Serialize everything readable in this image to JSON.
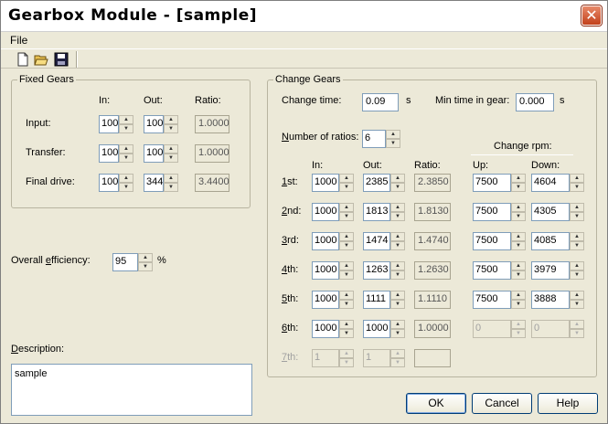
{
  "window": {
    "title": "Gearbox Module - [sample]",
    "close": "✕"
  },
  "menu": {
    "file": "File"
  },
  "fixed": {
    "label": "Fixed Gears",
    "headers": {
      "in": "In:",
      "out": "Out:",
      "ratio": "Ratio:"
    },
    "rows": [
      {
        "label": "Input:",
        "in": "100",
        "out": "100",
        "ratio": "1.0000"
      },
      {
        "label": "Transfer:",
        "in": "100",
        "out": "100",
        "ratio": "1.0000"
      },
      {
        "label": "Final drive:",
        "in": "100",
        "out": "344",
        "ratio": "3.4400"
      }
    ]
  },
  "efficiency": {
    "label_pre": "Overall ",
    "label_u": "e",
    "label_post": "fficiency:",
    "value": "95",
    "unit": "%"
  },
  "description": {
    "label_u": "D",
    "label_post": "escription:",
    "value": "sample"
  },
  "change": {
    "label": "Change Gears",
    "change_time": {
      "label": "Change time:",
      "value": "0.09",
      "unit": "s"
    },
    "min_time": {
      "label": "Min time in gear:",
      "value": "0.000",
      "unit": "s"
    },
    "num_ratios": {
      "label_u": "N",
      "label_post": "umber of ratios:",
      "value": "6"
    },
    "change_rpm": "Change rpm:",
    "headers": {
      "in": "In:",
      "out": "Out:",
      "ratio": "Ratio:",
      "up": "Up:",
      "down": "Down:"
    },
    "gears": [
      {
        "label_u": "1",
        "label_post": "st:",
        "in": "1000",
        "out": "2385",
        "ratio": "2.3850",
        "up": "7500",
        "down": "4604",
        "enabled": true,
        "rpm_enabled": true
      },
      {
        "label_u": "2",
        "label_post": "nd:",
        "in": "1000",
        "out": "1813",
        "ratio": "1.8130",
        "up": "7500",
        "down": "4305",
        "enabled": true,
        "rpm_enabled": true
      },
      {
        "label_u": "3",
        "label_post": "rd:",
        "in": "1000",
        "out": "1474",
        "ratio": "1.4740",
        "up": "7500",
        "down": "4085",
        "enabled": true,
        "rpm_enabled": true
      },
      {
        "label_u": "4",
        "label_post": "th:",
        "in": "1000",
        "out": "1263",
        "ratio": "1.2630",
        "up": "7500",
        "down": "3979",
        "enabled": true,
        "rpm_enabled": true
      },
      {
        "label_u": "5",
        "label_post": "th:",
        "in": "1000",
        "out": "1111",
        "ratio": "1.1110",
        "up": "7500",
        "down": "3888",
        "enabled": true,
        "rpm_enabled": true
      },
      {
        "label_u": "6",
        "label_post": "th:",
        "in": "1000",
        "out": "1000",
        "ratio": "1.0000",
        "up": "0",
        "down": "0",
        "enabled": true,
        "rpm_enabled": false
      },
      {
        "label_u": "7",
        "label_post": "th:",
        "in": "1",
        "out": "1",
        "ratio": "",
        "enabled": false,
        "rpm_enabled": false
      }
    ]
  },
  "buttons": {
    "ok": "OK",
    "cancel": "Cancel",
    "help": "Help"
  }
}
